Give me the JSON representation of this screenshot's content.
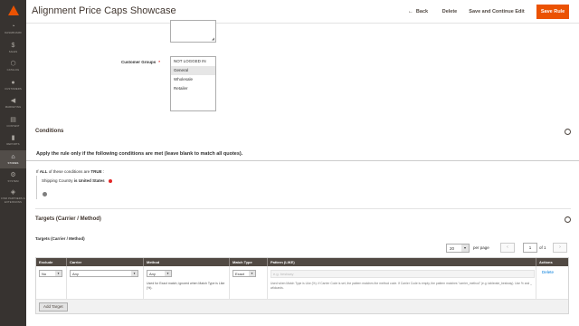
{
  "sidebar": {
    "items": [
      {
        "label": "Dashboard",
        "icon": "dashboard-icon",
        "glyph": "◔"
      },
      {
        "label": "Sales",
        "icon": "dollar-icon",
        "glyph": "$"
      },
      {
        "label": "Catalog",
        "icon": "cube-icon",
        "glyph": "⬡"
      },
      {
        "label": "Customers",
        "icon": "person-icon",
        "glyph": "●"
      },
      {
        "label": "Marketing",
        "icon": "megaphone-icon",
        "glyph": "◀"
      },
      {
        "label": "Content",
        "icon": "layout-icon",
        "glyph": "▤"
      },
      {
        "label": "Reports",
        "icon": "bar-chart-icon",
        "glyph": "▮"
      },
      {
        "label": "Stores",
        "icon": "store-icon",
        "glyph": "⌂"
      },
      {
        "label": "System",
        "icon": "gear-icon",
        "glyph": "⚙"
      },
      {
        "label": "Find Partners & Extensions",
        "icon": "cubes-icon",
        "glyph": "◈"
      }
    ],
    "active_index": 7
  },
  "header": {
    "title": "Alignment Price Caps Showcase",
    "back": "Back",
    "back_glyph": "←",
    "delete": "Delete",
    "save_continue": "Save and Continue Edit",
    "save": "Save Rule"
  },
  "customer_groups": {
    "label": "Customer Groups",
    "required": "*",
    "options": [
      "NOT LOGGED IN",
      "General",
      "Wholesale",
      "Retailer"
    ],
    "selected_index": 1
  },
  "conditions": {
    "title": "Conditions",
    "note": "Apply the rule only if the following conditions are met (leave blank to match all quotes).",
    "if": "If",
    "aggregator": "ALL",
    "of_these": "of these conditions are",
    "value": "TRUE",
    "colon": ":",
    "item_attr": "Shipping Country",
    "item_op": "is",
    "item_val": "United States"
  },
  "targets": {
    "title": "Targets (Carrier / Method)",
    "subtitle": "Targets (Carrier / Method)",
    "per_page_value": "20",
    "per_page_label": "per page",
    "page_value": "1",
    "of_pages": "of 1",
    "prev": "‹",
    "next": "›",
    "columns": [
      "Exclude",
      "Carrier",
      "Method",
      "Match Type",
      "Pattern (LIKE)",
      "Actions"
    ],
    "row": {
      "exclude": "No",
      "carrier": "Any",
      "method": "Any",
      "method_help": "Used for Exact match; ignored when Match Type is Like (%).",
      "match_type": "Exact",
      "pattern_placeholder": "e.g. bestway",
      "pattern_help": "Used when Match Type is Like (%). If Carrier Code is set, the pattern matches the method code. If Carrier Code is empty, the pattern matches \"carrier_method\" (e.g. tablerate_bestway). Use % and _ wildcards.",
      "action": "Delete"
    },
    "add_button": "Add Target"
  },
  "colors": {
    "accent": "#eb5202",
    "sidebar_bg": "#373330",
    "grid_header": "#514943",
    "link": "#007bdb"
  }
}
